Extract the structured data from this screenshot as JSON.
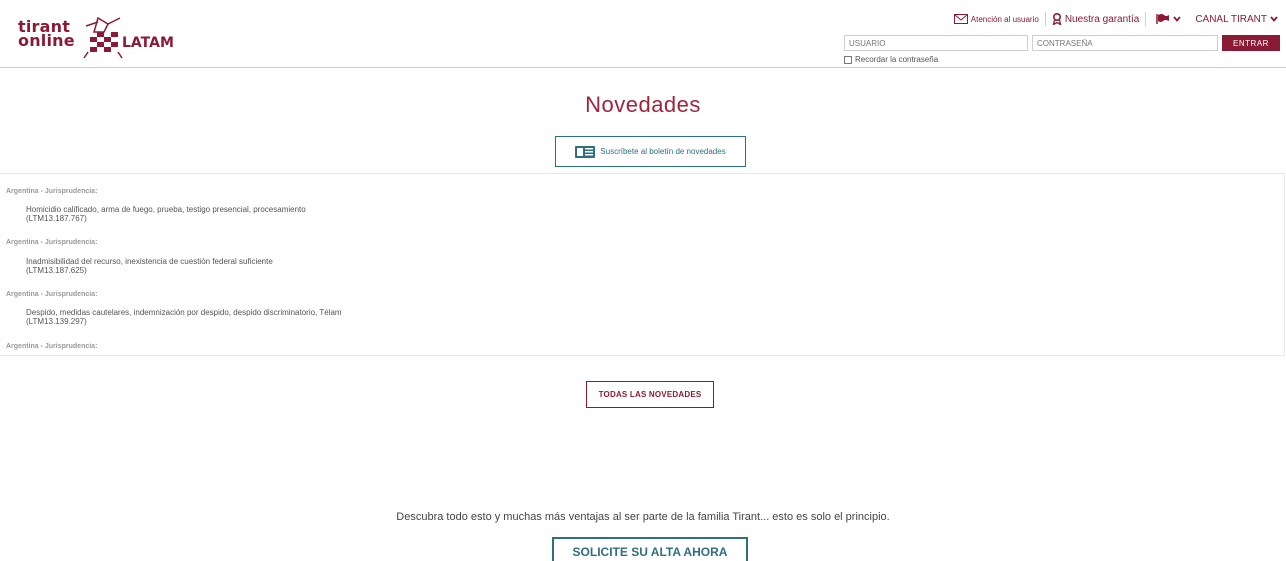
{
  "header": {
    "logo": {
      "line1": "tirant",
      "line2": "online",
      "region": "LATAM"
    },
    "links": {
      "support": "Atención al usuario",
      "guarantee": "Nuestra garantía",
      "channel": "CANAL TIRANT"
    },
    "login": {
      "user_placeholder": "USUARIO",
      "password_placeholder": "CONTRASEÑA",
      "enter_label": "ENTRAR",
      "remember_label": "Recordar la contraseña"
    }
  },
  "news": {
    "title": "Novedades",
    "subscribe_label": "Suscríbete al boletín de novedades",
    "items": [
      {
        "category": "Argentina - Jurisprudencia:",
        "text": "Homicidio calificado, arma de fuego, prueba, testigo presencial, procesamiento",
        "ref": "(LTM13.187.767)"
      },
      {
        "category": "Argentina - Jurisprudencia:",
        "text": "Inadmisibilidad del recurso, inexistencia de cuestión federal suficiente",
        "ref": "(LTM13.187.625)"
      },
      {
        "category": "Argentina - Jurisprudencia:",
        "text": "Despido, medidas cautelares, indemnización por despido, despido discriminatorio, Télam",
        "ref": "(LTM13.139.297)"
      },
      {
        "category": "Argentina - Jurisprudencia:"
      }
    ],
    "all_label": "TODAS LAS NOVEDADES"
  },
  "footer": {
    "tagline": "Descubra todo esto y muchas más ventajas al ser parte de la familia Tirant... esto es solo el principio.",
    "cta_label": "SOLICITE SU ALTA AHORA"
  },
  "colors": {
    "brand": "#8b1b35",
    "accent": "#2e6f80"
  }
}
